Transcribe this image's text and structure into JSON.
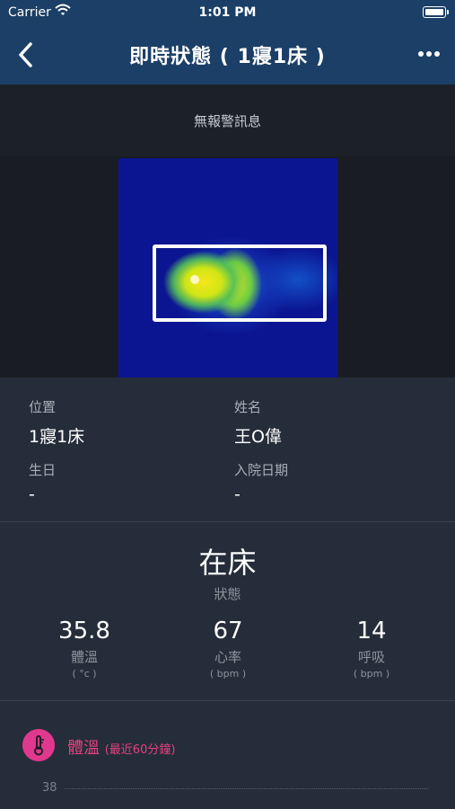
{
  "status_bar": {
    "carrier": "Carrier",
    "time": "1:01 PM"
  },
  "nav": {
    "title": "即時狀態 ( 1寢1床 )"
  },
  "alert": {
    "message": "無報警訊息"
  },
  "info": {
    "position_label": "位置",
    "position_value": "1寢1床",
    "name_label": "姓名",
    "name_value": "王O偉",
    "birthday_label": "生日",
    "birthday_value": "-",
    "admission_label": "入院日期",
    "admission_value": "-"
  },
  "status": {
    "state_value": "在床",
    "state_label": "狀態",
    "metrics": [
      {
        "value": "35.8",
        "label": "體溫",
        "unit": "( °c )"
      },
      {
        "value": "67",
        "label": "心率",
        "unit": "( bpm )"
      },
      {
        "value": "14",
        "label": "呼吸",
        "unit": "( bpm )"
      }
    ]
  },
  "chart": {
    "title": "體溫",
    "subtitle": "(最近60分鐘)",
    "tick": "38"
  },
  "icons": {
    "back": "chevron-left-icon",
    "more": "more-icon",
    "temperature": "thermometer-icon",
    "wifi": "wifi-icon",
    "battery": "battery-icon"
  },
  "colors": {
    "nav": "#1b3f66",
    "accent": "#e0388c",
    "background": "#222a36"
  }
}
